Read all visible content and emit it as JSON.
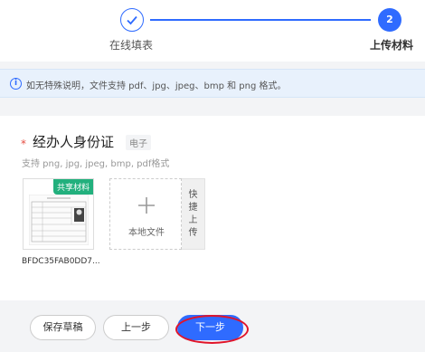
{
  "steps": [
    {
      "label": "在线填表",
      "status": "done"
    },
    {
      "label": "上传材料",
      "number": "2",
      "status": "active"
    }
  ],
  "notice": {
    "text": "如无特殊说明，文件支持 pdf、jpg、jpeg、bmp 和 png 格式。",
    "icon": "info-icon"
  },
  "upload": {
    "title": "经办人身份证",
    "tag": "电子",
    "hint": "支持 png, jpg, jpeg, bmp, pdf格式",
    "file": {
      "badge": "共享材料",
      "name": "BFDC35FAB0DD7..."
    },
    "local_label": "本地文件",
    "quick_upload": [
      "快",
      "捷",
      "上",
      "传"
    ]
  },
  "buttons": {
    "draft": "保存草稿",
    "prev": "上一步",
    "next": "下一步"
  },
  "colors": {
    "primary": "#2f6bff",
    "badge": "#22b07d",
    "required": "#e54d42",
    "annotation": "#e0142a"
  }
}
